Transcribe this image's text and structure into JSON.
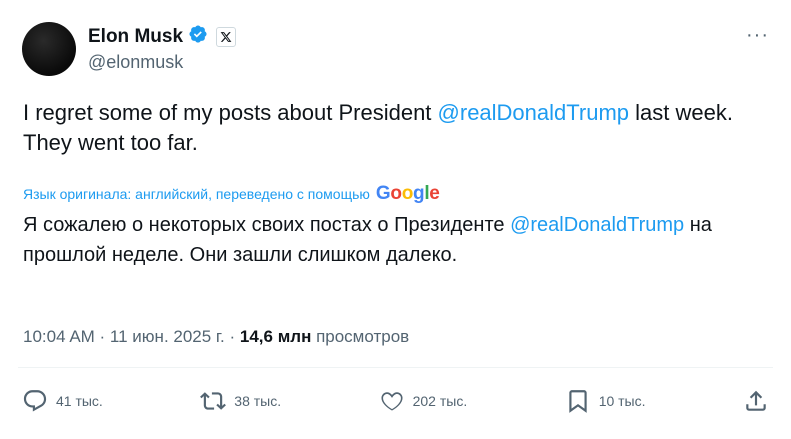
{
  "author": {
    "display_name": "Elon Musk",
    "handle": "@elonmusk",
    "verified_icon": "verified-badge-icon",
    "affiliation_icon": "x-logo-icon"
  },
  "post": {
    "text_before": "I regret some of my posts about President ",
    "mention": "@realDonaldTrump",
    "text_after": " last week. They went too far."
  },
  "translation": {
    "note": "Язык оригинала: английский, переведено с помощью",
    "provider": "Google",
    "text_before": "Я сожалею о некоторых своих постах о Президенте ",
    "mention": "@realDonaldTrump",
    "text_after": " на прошлой неделе. Они зашли слишком далеко."
  },
  "meta": {
    "timestamp": "10:04 AM · 11 июн. 2025 г. · ",
    "views_count": "14,6 млн",
    "views_label": " просмотров"
  },
  "actions": {
    "replies": "41 тыс.",
    "reposts": "38 тыс.",
    "likes": "202 тыс.",
    "bookmarks": "10 тыс."
  },
  "colors": {
    "accent": "#1d9bf0",
    "secondary_text": "#536471",
    "primary_text": "#0f1419"
  }
}
